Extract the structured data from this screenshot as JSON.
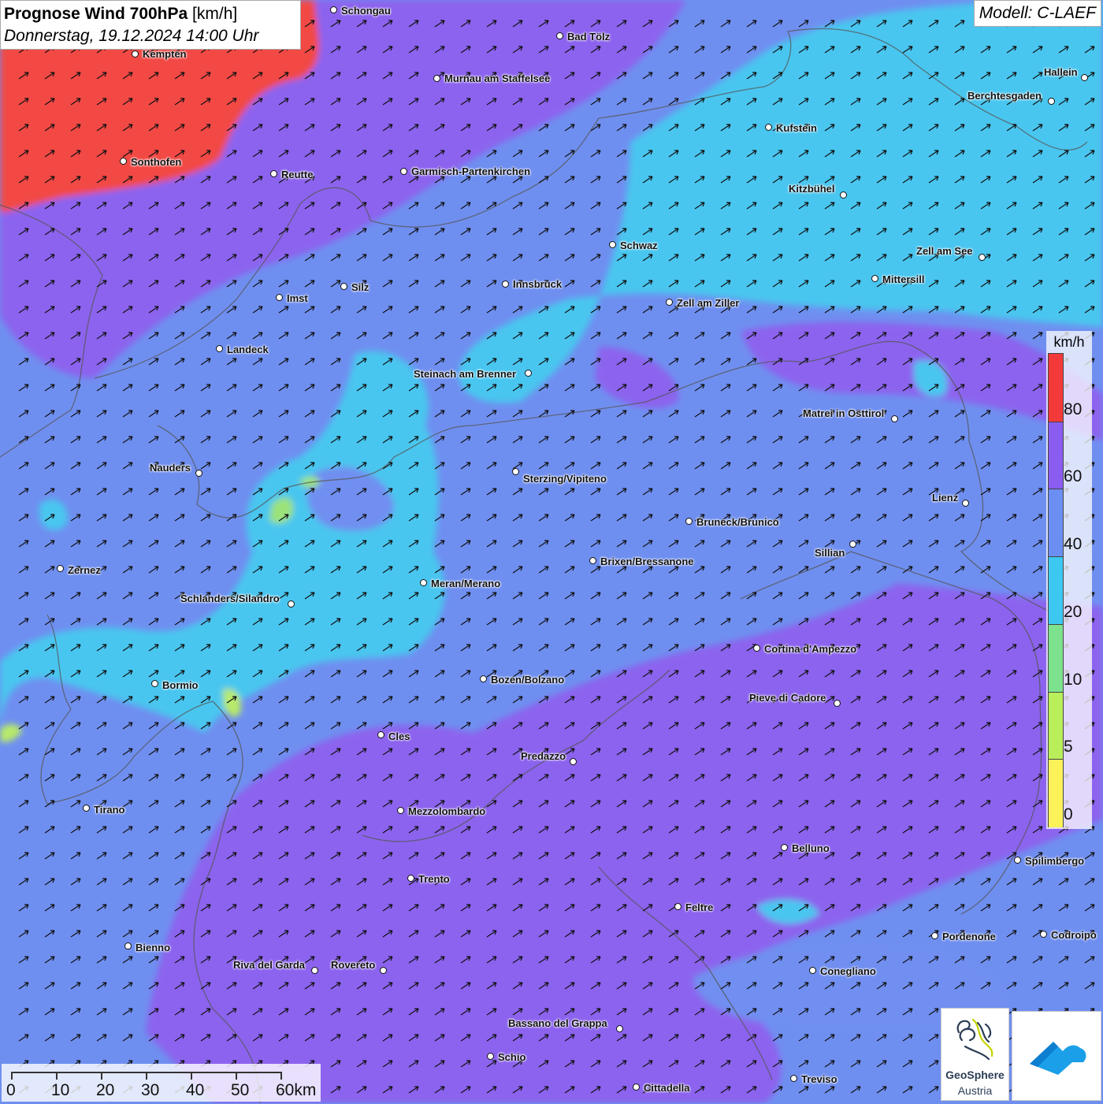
{
  "header": {
    "title_bold": "Prognose Wind 700hPa",
    "title_unit": "[km/h]",
    "datetime": "Donnerstag, 19.12.2024 14:00 Uhr",
    "model": "Modell: C-LAEF"
  },
  "legend": {
    "unit": "km/h",
    "levels": [
      {
        "label": "80",
        "color": "#f23a3a"
      },
      {
        "label": "60",
        "color": "#8a5cf0"
      },
      {
        "label": "40",
        "color": "#6a8ef2"
      },
      {
        "label": "20",
        "color": "#3cc8f0"
      },
      {
        "label": "10",
        "color": "#7de28e"
      },
      {
        "label": "5",
        "color": "#b8ef5a"
      },
      {
        "label": "0",
        "color": "#fbf25a"
      }
    ],
    "top_color": "#f23a3a"
  },
  "scale": {
    "labels": [
      "0",
      "10",
      "20",
      "30",
      "40",
      "50",
      "60km"
    ]
  },
  "logos": {
    "geosphere_line1": "GeoSphere",
    "geosphere_line2": "Austria"
  },
  "cities": [
    {
      "name": "Schongau",
      "dot": [
        424,
        13
      ],
      "label": [
        433,
        14
      ]
    },
    {
      "name": "Kempten",
      "dot": [
        172,
        69
      ],
      "label": [
        181,
        69
      ]
    },
    {
      "name": "Bad Tölz",
      "dot": [
        711,
        46
      ],
      "label": [
        720,
        47
      ]
    },
    {
      "name": "Murnau am Staffelsee",
      "dot": [
        555,
        100
      ],
      "label": [
        564,
        100
      ]
    },
    {
      "name": "Hallein",
      "dot": [
        1377,
        99
      ],
      "label": [
        1325,
        92
      ]
    },
    {
      "name": "Berchtesgaden",
      "dot": [
        1335,
        129
      ],
      "label": [
        1228,
        122
      ]
    },
    {
      "name": "Kufstein",
      "dot": [
        976,
        162
      ],
      "label": [
        985,
        163
      ]
    },
    {
      "name": "Sonthofen",
      "dot": [
        157,
        205
      ],
      "label": [
        166,
        206
      ]
    },
    {
      "name": "Reutte",
      "dot": [
        348,
        221
      ],
      "label": [
        357,
        222
      ]
    },
    {
      "name": "Garmisch-Partenkirchen",
      "dot": [
        513,
        218
      ],
      "label": [
        522,
        218
      ]
    },
    {
      "name": "Kitzbühel",
      "dot": [
        1071,
        248
      ],
      "label": [
        1001,
        240
      ]
    },
    {
      "name": "Schwaz",
      "dot": [
        778,
        311
      ],
      "label": [
        787,
        312
      ]
    },
    {
      "name": "Zell am See",
      "dot": [
        1247,
        327
      ],
      "label": [
        1163,
        319
      ]
    },
    {
      "name": "Mittersill",
      "dot": [
        1111,
        354
      ],
      "label": [
        1120,
        355
      ]
    },
    {
      "name": "Innsbruck",
      "dot": [
        642,
        361
      ],
      "label": [
        651,
        361
      ]
    },
    {
      "name": "Silz",
      "dot": [
        437,
        364
      ],
      "label": [
        446,
        365
      ]
    },
    {
      "name": "Imst",
      "dot": [
        355,
        378
      ],
      "label": [
        364,
        379
      ]
    },
    {
      "name": "Zell am Ziller",
      "dot": [
        850,
        384
      ],
      "label": [
        859,
        385
      ]
    },
    {
      "name": "Landeck",
      "dot": [
        279,
        443
      ],
      "label": [
        288,
        444
      ]
    },
    {
      "name": "Steinach am Brenner",
      "dot": [
        671,
        474
      ],
      "label": [
        525,
        475
      ]
    },
    {
      "name": "Matrei in Osttirol",
      "dot": [
        1136,
        532
      ],
      "label": [
        1019,
        525
      ]
    },
    {
      "name": "Nauders",
      "dot": [
        253,
        601
      ],
      "label": [
        190,
        594
      ]
    },
    {
      "name": "Sterzing/Vipiteno",
      "dot": [
        655,
        599
      ],
      "label": [
        664,
        608
      ]
    },
    {
      "name": "Lienz",
      "dot": [
        1226,
        639
      ],
      "label": [
        1183,
        632
      ]
    },
    {
      "name": "Bruneck/Brunico",
      "dot": [
        875,
        662
      ],
      "label": [
        884,
        663
      ]
    },
    {
      "name": "Sillian",
      "dot": [
        1083,
        691
      ],
      "label": [
        1034,
        702
      ]
    },
    {
      "name": "Brixen/Bressanone",
      "dot": [
        753,
        712
      ],
      "label": [
        762,
        713
      ]
    },
    {
      "name": "Zernez",
      "dot": [
        77,
        722
      ],
      "label": [
        86,
        724
      ]
    },
    {
      "name": "Meran/Merano",
      "dot": [
        538,
        740
      ],
      "label": [
        547,
        741
      ]
    },
    {
      "name": "Schlanders/Silandro",
      "dot": [
        370,
        767
      ],
      "label": [
        229,
        760
      ]
    },
    {
      "name": "Cortina d'Ampezzo",
      "dot": [
        961,
        823
      ],
      "label": [
        970,
        824
      ]
    },
    {
      "name": "Bozen/Bolzano",
      "dot": [
        614,
        862
      ],
      "label": [
        623,
        863
      ]
    },
    {
      "name": "Bormio",
      "dot": [
        197,
        868
      ],
      "label": [
        206,
        870
      ]
    },
    {
      "name": "Pieve di Cadore",
      "dot": [
        1063,
        893
      ],
      "label": [
        951,
        886
      ]
    },
    {
      "name": "Cles",
      "dot": [
        484,
        933
      ],
      "label": [
        493,
        935
      ]
    },
    {
      "name": "Predazzo",
      "dot": [
        728,
        967
      ],
      "label": [
        661,
        960
      ]
    },
    {
      "name": "Tirano",
      "dot": [
        110,
        1026
      ],
      "label": [
        119,
        1028
      ]
    },
    {
      "name": "Mezzolombardo",
      "dot": [
        509,
        1029
      ],
      "label": [
        518,
        1030
      ]
    },
    {
      "name": "Belluno",
      "dot": [
        996,
        1076
      ],
      "label": [
        1005,
        1077
      ]
    },
    {
      "name": "Spilimbergo",
      "dot": [
        1292,
        1092
      ],
      "label": [
        1301,
        1093
      ]
    },
    {
      "name": "Trento",
      "dot": [
        522,
        1115
      ],
      "label": [
        531,
        1116
      ]
    },
    {
      "name": "Feltre",
      "dot": [
        861,
        1151
      ],
      "label": [
        870,
        1152
      ]
    },
    {
      "name": "Pordenone",
      "dot": [
        1187,
        1188
      ],
      "label": [
        1196,
        1189
      ]
    },
    {
      "name": "Codroipo",
      "dot": [
        1325,
        1186
      ],
      "label": [
        1334,
        1187
      ]
    },
    {
      "name": "Bienno",
      "dot": [
        163,
        1201
      ],
      "label": [
        172,
        1203
      ]
    },
    {
      "name": "Riva del Garda",
      "dot": [
        400,
        1232
      ],
      "label": [
        296,
        1225
      ]
    },
    {
      "name": "Rovereto",
      "dot": [
        487,
        1232
      ],
      "label": [
        420,
        1225
      ]
    },
    {
      "name": "Conegliano",
      "dot": [
        1032,
        1232
      ],
      "label": [
        1041,
        1233
      ]
    },
    {
      "name": "Bassano del Grappa",
      "dot": [
        787,
        1306
      ],
      "label": [
        645,
        1299
      ]
    },
    {
      "name": "Schio",
      "dot": [
        623,
        1341
      ],
      "label": [
        632,
        1342
      ]
    },
    {
      "name": "Treviso",
      "dot": [
        1008,
        1369
      ],
      "label": [
        1017,
        1370
      ]
    },
    {
      "name": "Cittadella",
      "dot": [
        808,
        1380
      ],
      "label": [
        817,
        1381
      ]
    }
  ]
}
